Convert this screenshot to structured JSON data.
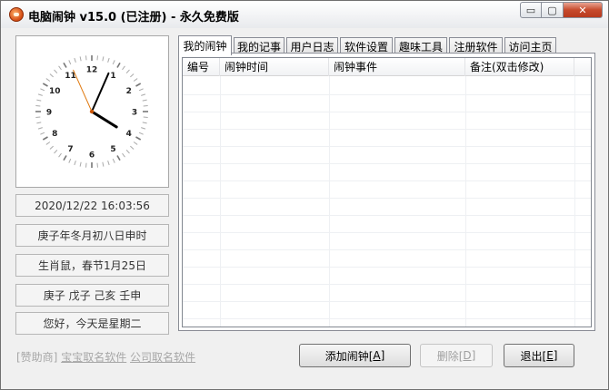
{
  "window": {
    "title": "电脑闹钟 v15.0 (已注册) - 永久免费版",
    "controls": {
      "minimize": "▭",
      "maximize": "▢",
      "close": "✕"
    }
  },
  "clock": {
    "numerals": [
      "12",
      "1",
      "2",
      "3",
      "4",
      "5",
      "6",
      "7",
      "8",
      "9",
      "10",
      "11"
    ],
    "time": {
      "hour": 16,
      "minute": 3,
      "second": 56
    }
  },
  "info": {
    "datetime": "2020/12/22  16:03:56",
    "lunar": "庚子年冬月初八日申时",
    "zodiac": "生肖鼠，春节1月25日",
    "ganzhi": "庚子  戊子  己亥  壬申",
    "greeting": "您好，今天是星期二"
  },
  "tabs": [
    "我的闹钟",
    "我的记事",
    "用户日志",
    "软件设置",
    "趣味工具",
    "注册软件",
    "访问主页"
  ],
  "active_tab": 0,
  "list": {
    "columns": [
      "编号",
      "闹钟时间",
      "闹钟事件",
      "备注(双击修改)"
    ],
    "rows": []
  },
  "footer": {
    "sponsor_prefix": "[赞助商]",
    "sponsor_links": [
      "宝宝取名软件",
      "公司取名软件"
    ]
  },
  "buttons": {
    "add": {
      "label": "添加闹钟[",
      "key": "A",
      "suffix": "]"
    },
    "delete": {
      "label": "删除[",
      "key": "D",
      "suffix": "]"
    },
    "exit": {
      "label": "退出[",
      "key": "E",
      "suffix": "]"
    }
  },
  "colors": {
    "second_hand": "#e07a10",
    "hands": "#000000",
    "close_button": "#c74a2c"
  }
}
